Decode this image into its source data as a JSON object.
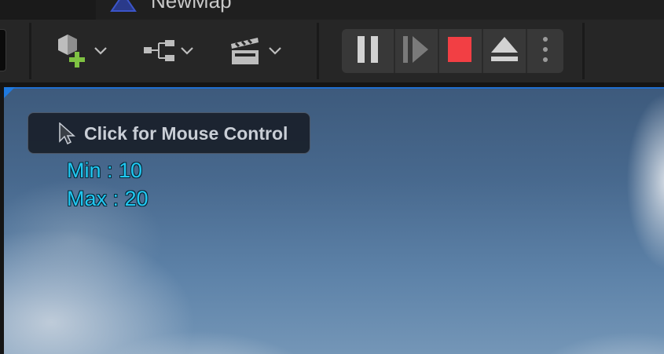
{
  "tab": {
    "title": "NewMap",
    "icon": "unreal-logo-icon"
  },
  "toolbar": {
    "add_icon": "add-actor-icon",
    "blueprint_icon": "blueprint-graph-icon",
    "cinematics_icon": "clapperboard-icon",
    "dropdown_icon": "chevron-down-icon",
    "accent_add": "#7fc242"
  },
  "play_controls": {
    "pause_icon": "pause-icon",
    "step_icon": "step-frame-icon",
    "stop_icon": "stop-icon",
    "stop_color": "#f23f44",
    "eject_icon": "eject-icon",
    "more_icon": "more-vertical-icon"
  },
  "viewport": {
    "mouse_control_label": "Click for Mouse Control",
    "min_text": "Min : 10",
    "max_text": "Max : 20",
    "stat_color": "#21c8f2",
    "accent": "#1f7ae0"
  }
}
